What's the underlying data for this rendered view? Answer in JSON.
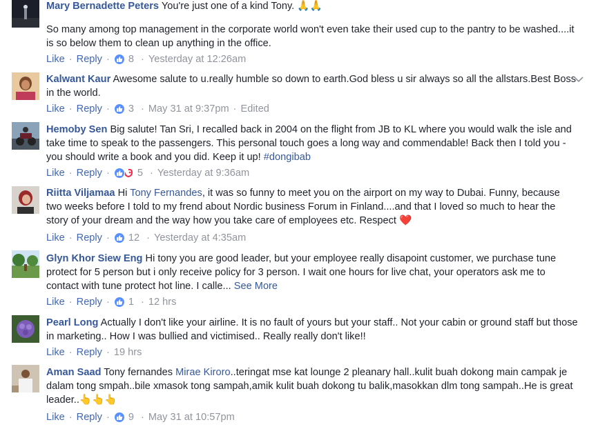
{
  "actions": {
    "like": "Like",
    "reply": "Reply",
    "sep": "·"
  },
  "colors": {
    "link": "#365899",
    "meta": "#90949c",
    "like_blue": "#5890ff",
    "heart": "#f25268"
  },
  "comments": [
    {
      "author": "Mary Bernadette Peters",
      "text": "You're just one of a kind Tony.",
      "emoji": "🙏🙏",
      "text2": "So many among top management in the corporate world won't even take their used cup to the pantry to be washed....it is so below them to clean up anything in the office.",
      "reactions": "8",
      "time": "Yesterday at 12:26am",
      "avatar": "night-sky-avatar"
    },
    {
      "author": "Kalwant Kaur",
      "text": "Awesome salute to u.really humble so down to earth.God bless u sir always so all the allstars.Best Boss in the world.",
      "reactions": "3",
      "time": "May 31 at 9:37pm",
      "edited": "Edited",
      "avatar": "woman-portrait-avatar"
    },
    {
      "author": "Hemoby Sen",
      "text": "Big salute! Tan Sri, I recalled back in 2004 on the flight from JB to KL where you would walk the isle and take time to speak to the passengers. This personal touch goes a long way and commendable! Back then I told you - you should write a book and you did. Keep it up!",
      "hashtag": "#dongibab",
      "reactions": "5",
      "time": "Yesterday at 9:36am",
      "avatar": "motorbike-avatar"
    },
    {
      "author": "Riitta Viljamaa",
      "pre": "Hi",
      "mention": "Tony Fernandes",
      "text": ", it was so funny to meet you on the airport on my way to Dubai. Funny, because two weeks before I told to my frend about Nordic business Forum in Finland....and that I loved so much to hear the story of your dream and the way how you take care of employees etc. Respect",
      "emoji": "❤️",
      "reactions": "12",
      "time": "Yesterday at 4:35am",
      "avatar": "red-hair-avatar"
    },
    {
      "author": "Glyn Khor Siew Eng",
      "text": "Hi tony you are good leader, but your employee really disapoint customer, we purchase tune protect for 5 person but i only receive policy for 3 person. I wait one hours for live chat, your operators ask me to contact with tune protect hot line. I calle...",
      "see_more": "See More",
      "reactions": "1",
      "time": "12 hrs",
      "avatar": "park-avatar"
    },
    {
      "author": "Pearl Long",
      "text": "Actually I don't like your airline. It is no fault of yours but your staff.. Not your cabin or ground staff but those in marketing.. How I was bullied and victimised.. Really really don't like!!",
      "time": "19 hrs",
      "avatar": "purple-flower-avatar"
    },
    {
      "author": "Aman Saad",
      "pre": "Tony fernandes",
      "mention": "Mirae Kiroro",
      "text": "..teringat mse kat lounge 2 pleanary hall..kulit buah dokong main campak je dalam tong smpah..bile xmasok tong sampah,amik kulit buah dokong tu balik,masokkan dlm tong sampah..He is great leader..",
      "emoji": "👆👆👆",
      "reactions": "9",
      "time": "May 31 at 10:57pm",
      "avatar": "man-white-shirt-avatar"
    }
  ]
}
